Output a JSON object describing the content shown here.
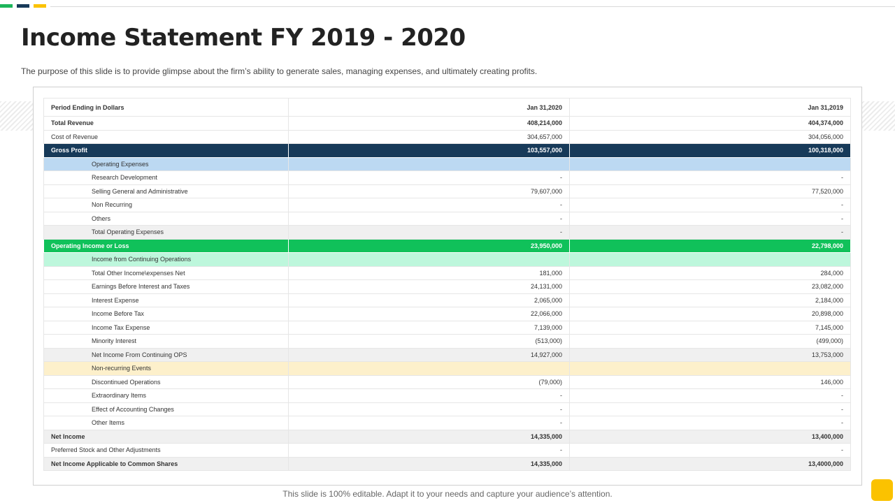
{
  "colors": {
    "accent_green": "#1cb55a",
    "accent_navy": "#173a59",
    "accent_yellow": "#fbc200",
    "gross_profit_row": "#173a59",
    "operating_income_row": "#10c15a",
    "category_blue": "#bcd9f2",
    "category_green": "#bdf7dc",
    "category_yellow": "#fdf0cb"
  },
  "title": "Income Statement FY 2019 - 2020",
  "subtitle": "The purpose of this slide is to provide glimpse about the firm’s ability to generate sales, managing expenses, and ultimately creating profits.",
  "table": {
    "header": [
      "Period Ending in Dollars",
      "Jan 31,2020",
      "Jan 31,2019"
    ],
    "rows": [
      {
        "label": "Total Revenue",
        "v2020": "408,214,000",
        "v2019": "404,374,000"
      },
      {
        "label": "Cost of Revenue",
        "v2020": "304,657,000",
        "v2019": "304,056,000"
      },
      {
        "label": "Gross Profit",
        "v2020": "103,557,000",
        "v2019": "100,318,000"
      },
      {
        "label": "Operating Expenses",
        "v2020": "",
        "v2019": ""
      },
      {
        "label": "Research Development",
        "v2020": "-",
        "v2019": "-"
      },
      {
        "label": "Selling General and Administrative",
        "v2020": "79,607,000",
        "v2019": "77,520,000"
      },
      {
        "label": "Non Recurring",
        "v2020": "-",
        "v2019": "-"
      },
      {
        "label": "Others",
        "v2020": "-",
        "v2019": "-"
      },
      {
        "label": "Total Operating Expenses",
        "v2020": "-",
        "v2019": "-"
      },
      {
        "label": "Operating Income or Loss",
        "v2020": "23,950,000",
        "v2019": "22,798,000"
      },
      {
        "label": "Income from Continuing Operations",
        "v2020": "",
        "v2019": ""
      },
      {
        "label": "Total Other Income\\expenses Net",
        "v2020": "181,000",
        "v2019": "284,000"
      },
      {
        "label": "Earnings Before Interest and Taxes",
        "v2020": "24,131,000",
        "v2019": "23,082,000"
      },
      {
        "label": "Interest Expense",
        "v2020": "2,065,000",
        "v2019": "2,184,000"
      },
      {
        "label": "Income Before Tax",
        "v2020": "22,066,000",
        "v2019": "20,898,000"
      },
      {
        "label": "Income Tax Expense",
        "v2020": "7,139,000",
        "v2019": "7,145,000"
      },
      {
        "label": "Minority Interest",
        "v2020": "(513,000)",
        "v2019": "(499,000)"
      },
      {
        "label": "Net Income From Continuing OPS",
        "v2020": "14,927,000",
        "v2019": "13,753,000"
      },
      {
        "label": "Non-recurring Events",
        "v2020": "",
        "v2019": ""
      },
      {
        "label": "Discontinued Operations",
        "v2020": "(79,000)",
        "v2019": "146,000"
      },
      {
        "label": "Extraordinary Items",
        "v2020": "-",
        "v2019": "-"
      },
      {
        "label": "Effect of Accounting Changes",
        "v2020": "-",
        "v2019": "-"
      },
      {
        "label": "Other Items",
        "v2020": "-",
        "v2019": "-"
      },
      {
        "label": "Net Income",
        "v2020": "14,335,000",
        "v2019": "13,400,000"
      },
      {
        "label": "Preferred Stock and Other Adjustments",
        "v2020": "-",
        "v2019": "-"
      },
      {
        "label": "Net Income Applicable to Common Shares",
        "v2020": "14,335,000",
        "v2019": "13,4000,000"
      }
    ]
  },
  "footer": "This slide is 100% editable. Adapt it to your needs and capture your audience’s attention."
}
